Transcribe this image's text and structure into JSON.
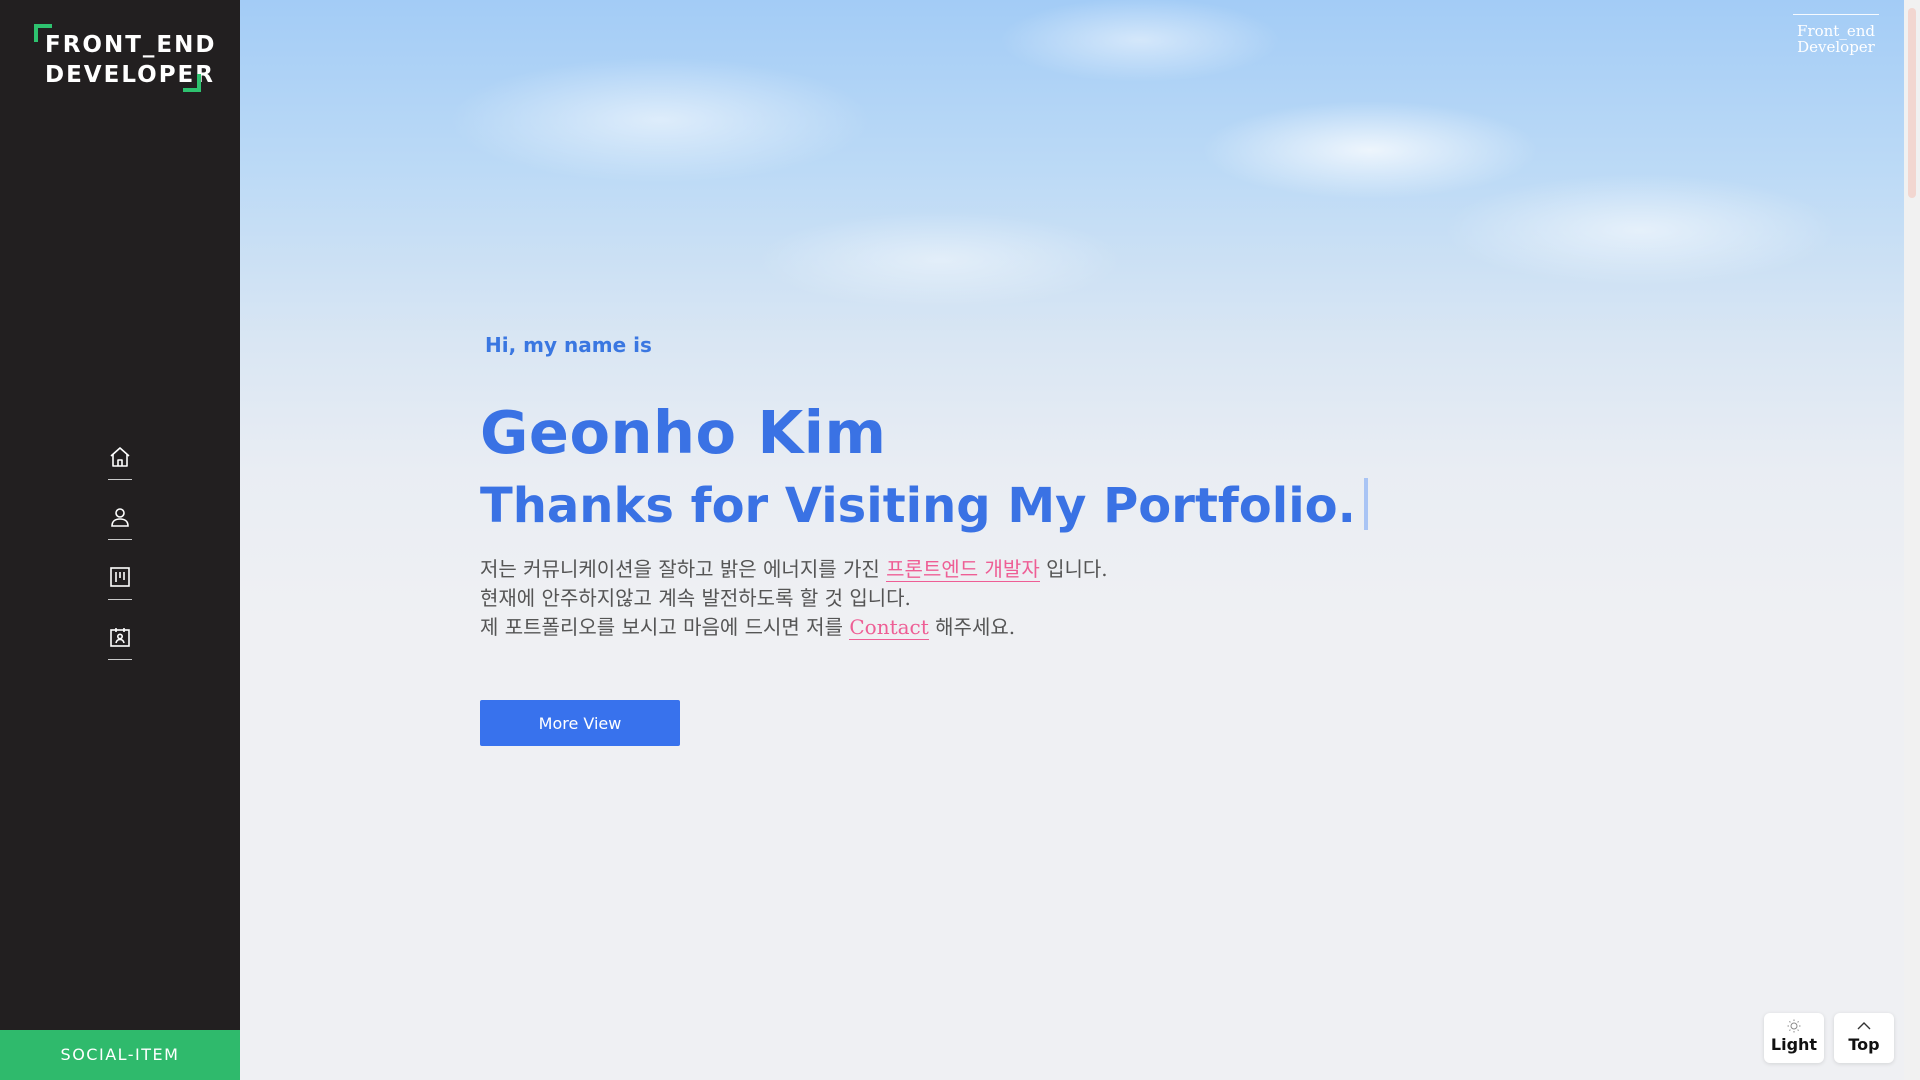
{
  "sidebar": {
    "logo_line1": "FRONT_END",
    "logo_line2": "DEVELOPER",
    "nav": [
      {
        "icon": "home-icon"
      },
      {
        "icon": "user-icon"
      },
      {
        "icon": "board-icon"
      },
      {
        "icon": "contact-card-icon"
      }
    ],
    "social_label": "SOCIAL-ITEM"
  },
  "header": {
    "corner_line1": "Front_end",
    "corner_line2": "Developer"
  },
  "hero": {
    "greeting": "Hi, my name is",
    "name": "Geonho Kim",
    "tagline": "Thanks for Visiting My Portfolio.",
    "intro_1_before": "저는 커뮤니케이션을 잘하고 밝은 에너지를 가진 ",
    "intro_1_highlight": "프론트엔드 개발자",
    "intro_1_after": " 입니다.",
    "intro_2": "현재에 안주하지않고 계속 발전하도록 할 것 입니다.",
    "intro_3_before": "제 포트폴리오를 보시고 마음에 드시면 저를 ",
    "intro_3_highlight": "Contact",
    "intro_3_after": " 해주세요.",
    "button_label": "More View"
  },
  "controls": {
    "theme_label": "Light",
    "top_label": "Top"
  },
  "colors": {
    "sidebar_bg": "#221f20",
    "accent_green": "#2fba6c",
    "accent_blue": "#3872ed",
    "highlight_pink": "#ee5e95"
  }
}
